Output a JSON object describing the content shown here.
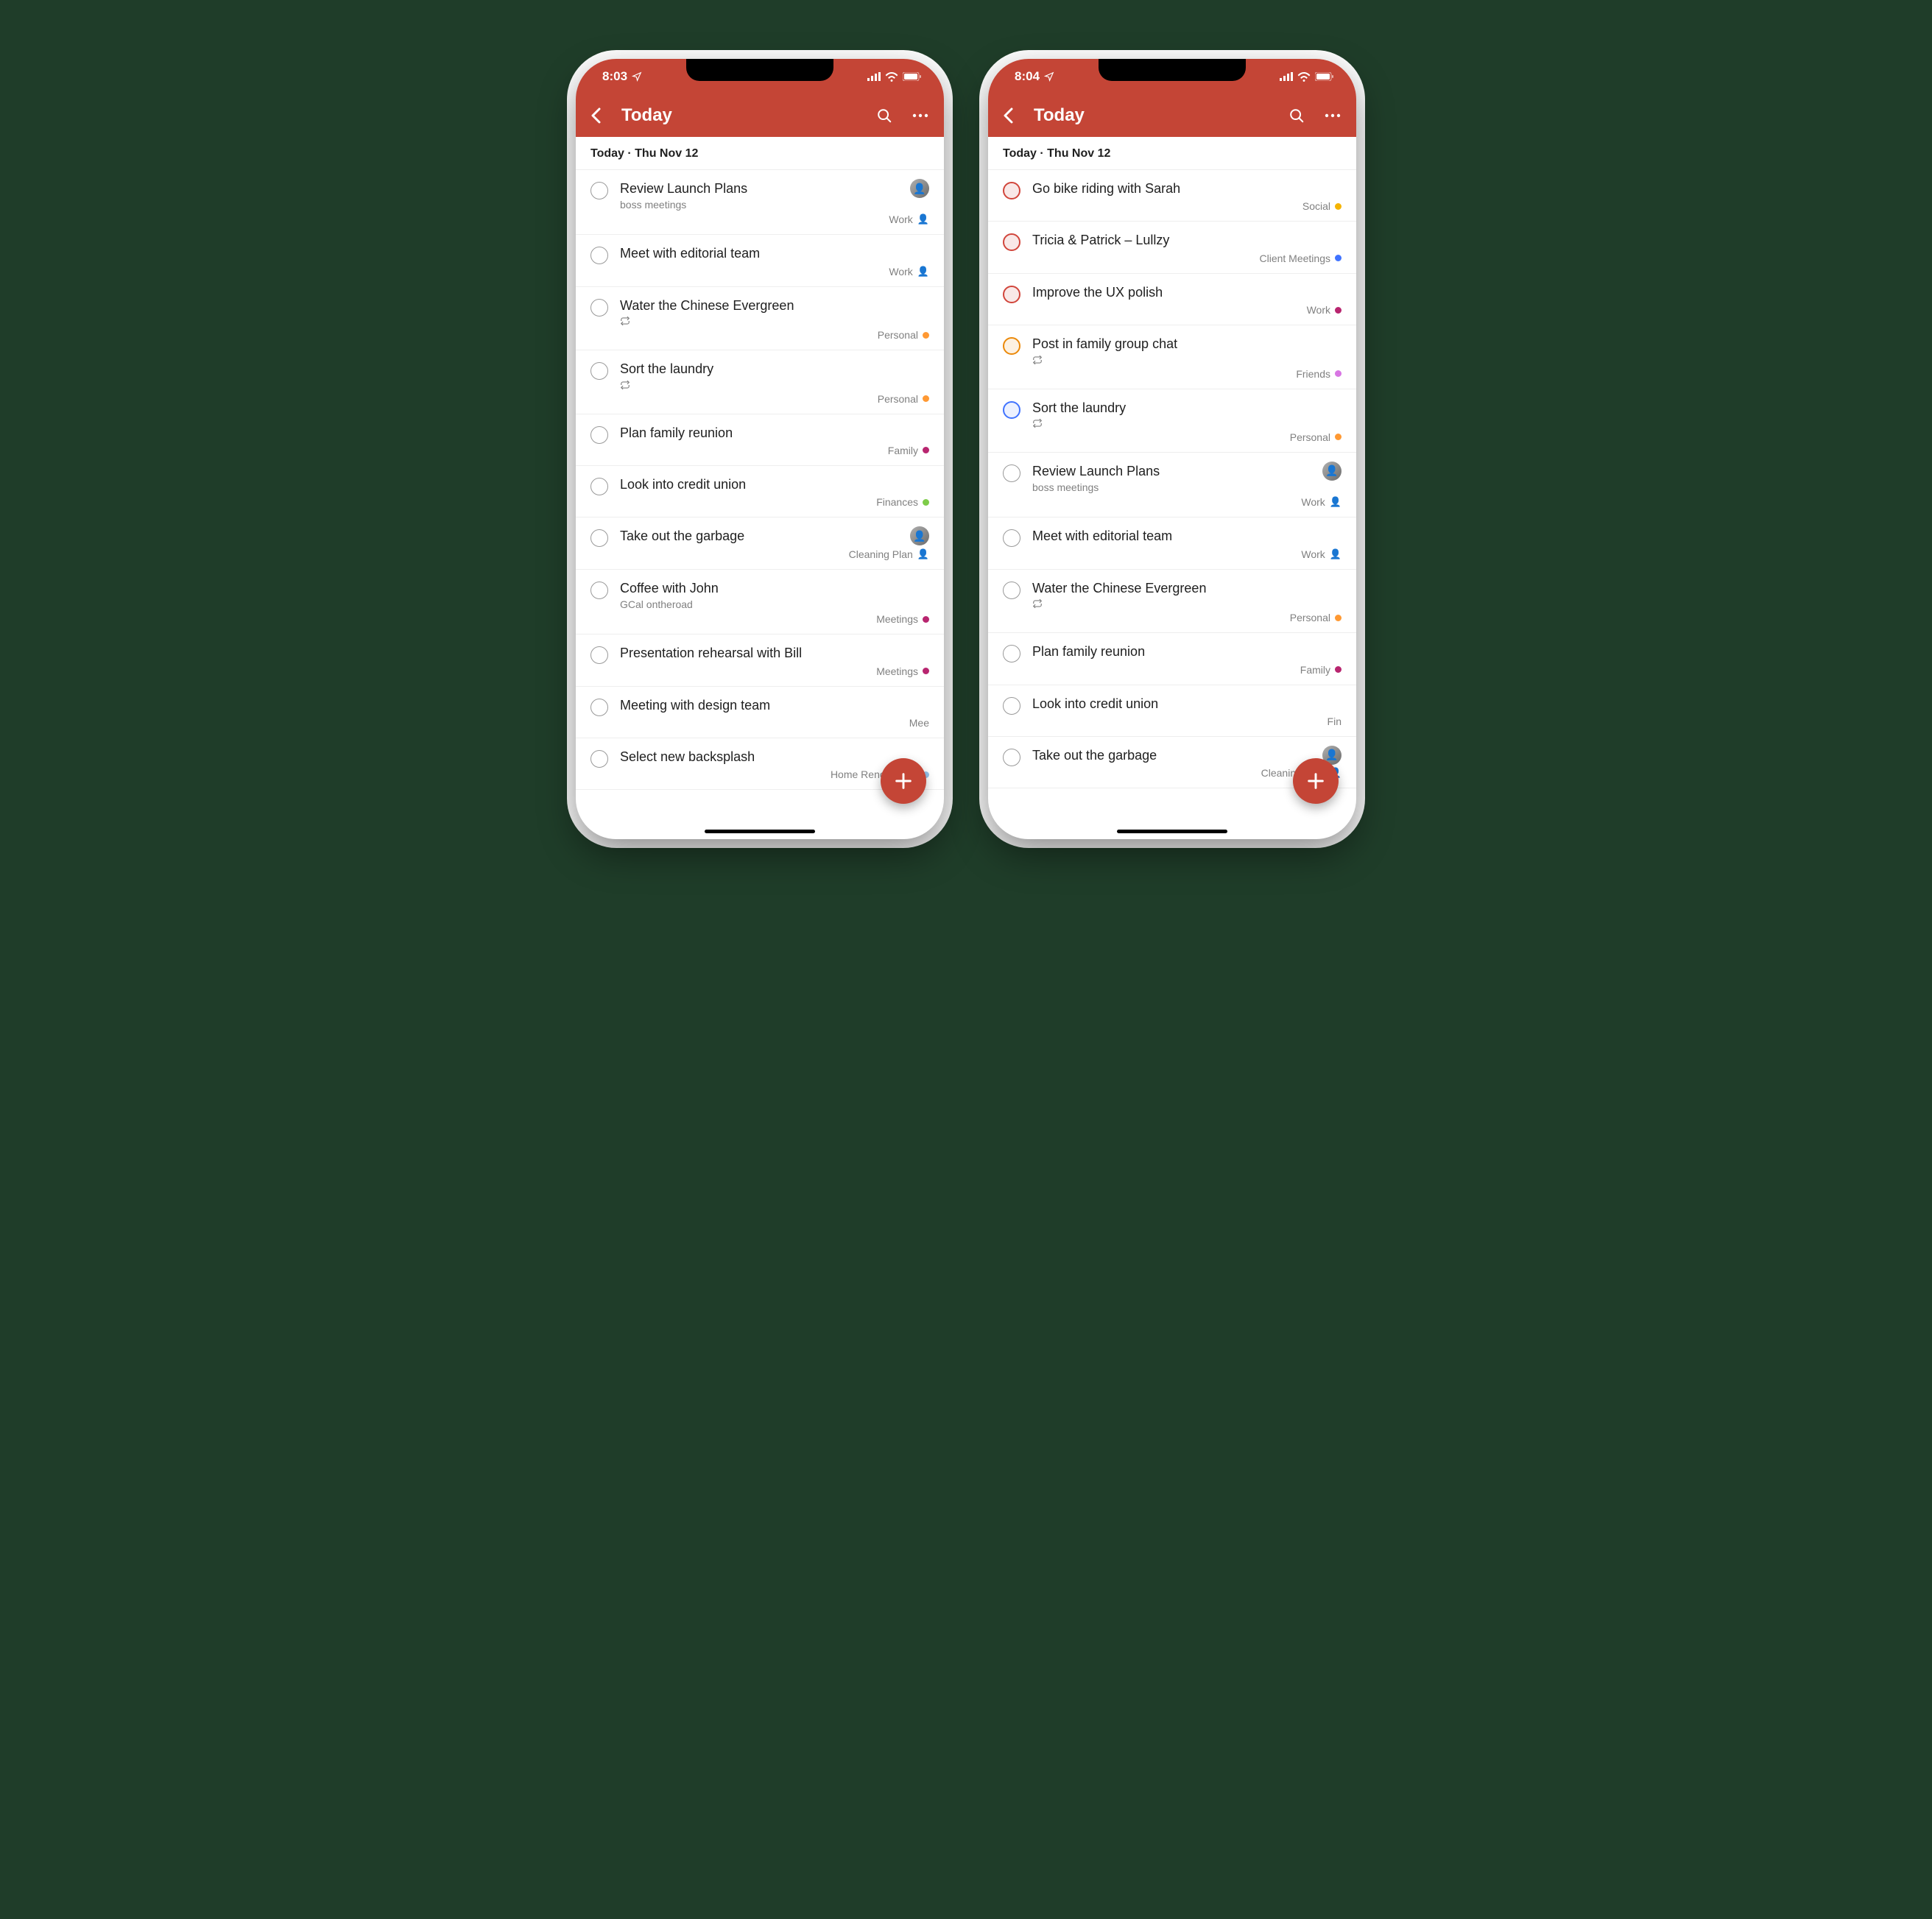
{
  "phones": [
    {
      "status": {
        "time": "8:03"
      },
      "header": {
        "title": "Today"
      },
      "section": "Today · Thu Nov 12",
      "tasks": [
        {
          "title": "Review Launch Plans",
          "subtitle": "boss meetings",
          "project": "Work",
          "projectIcon": "person",
          "projectColor": "#f5b400",
          "avatar": true,
          "priority": ""
        },
        {
          "title": "Meet with editorial team",
          "subtitle": "",
          "project": "Work",
          "projectIcon": "person",
          "projectColor": "#f5b400",
          "priority": ""
        },
        {
          "title": "Water the Chinese Evergreen",
          "subtitle": "",
          "recurring": true,
          "project": "Personal",
          "projectColor": "#ff9933",
          "priority": ""
        },
        {
          "title": "Sort the laundry",
          "subtitle": "",
          "recurring": true,
          "project": "Personal",
          "projectColor": "#ff9933",
          "priority": ""
        },
        {
          "title": "Plan family reunion",
          "subtitle": "",
          "project": "Family",
          "projectColor": "#b8256f",
          "priority": ""
        },
        {
          "title": "Look into credit union",
          "subtitle": "",
          "project": "Finances",
          "projectColor": "#7ecc49",
          "priority": ""
        },
        {
          "title": "Take out the garbage",
          "subtitle": "",
          "project": "Cleaning Plan",
          "projectIcon": "person",
          "projectColor": "#5ec5c5",
          "avatar": true,
          "priority": ""
        },
        {
          "title": "Coffee with John",
          "subtitle": "GCal ontheroad",
          "project": "Meetings",
          "projectColor": "#b8256f",
          "priority": ""
        },
        {
          "title": "Presentation rehearsal with Bill",
          "subtitle": "",
          "project": "Meetings",
          "projectColor": "#b8256f",
          "priority": ""
        },
        {
          "title": "Meeting with design team",
          "subtitle": "",
          "project": "Mee",
          "projectColor": "",
          "priority": ""
        },
        {
          "title": "Select new backsplash",
          "subtitle": "",
          "project": "Home Renovations",
          "projectColor": "#96c3eb",
          "priority": ""
        }
      ]
    },
    {
      "status": {
        "time": "8:04"
      },
      "header": {
        "title": "Today"
      },
      "section": "Today · Thu Nov 12",
      "tasks": [
        {
          "title": "Go bike riding with Sarah",
          "subtitle": "",
          "project": "Social",
          "projectColor": "#f5b400",
          "priority": "p1"
        },
        {
          "title": "Tricia & Patrick – Lullzy",
          "subtitle": "",
          "project": "Client Meetings",
          "projectColor": "#4073ff",
          "priority": "p1"
        },
        {
          "title": "Improve the UX polish",
          "subtitle": "",
          "project": "Work",
          "projectColor": "#b8256f",
          "priority": "p1"
        },
        {
          "title": "Post in family group chat",
          "subtitle": "",
          "recurring": true,
          "project": "Friends",
          "projectColor": "#d876e3",
          "priority": "p2"
        },
        {
          "title": "Sort the laundry",
          "subtitle": "",
          "recurring": true,
          "project": "Personal",
          "projectColor": "#ff9933",
          "priority": "p3"
        },
        {
          "title": "Review Launch Plans",
          "subtitle": "boss meetings",
          "project": "Work",
          "projectIcon": "person",
          "projectColor": "#f5b400",
          "avatar": true,
          "priority": ""
        },
        {
          "title": "Meet with editorial team",
          "subtitle": "",
          "project": "Work",
          "projectIcon": "person",
          "projectColor": "#f5b400",
          "priority": ""
        },
        {
          "title": "Water the Chinese Evergreen",
          "subtitle": "",
          "recurring": true,
          "project": "Personal",
          "projectColor": "#ff9933",
          "priority": ""
        },
        {
          "title": "Plan family reunion",
          "subtitle": "",
          "project": "Family",
          "projectColor": "#b8256f",
          "priority": ""
        },
        {
          "title": "Look into credit union",
          "subtitle": "",
          "project": "Fin",
          "projectColor": "",
          "priority": ""
        },
        {
          "title": "Take out the garbage",
          "subtitle": "",
          "project": "Cleaning Plan",
          "projectIcon": "person",
          "projectColor": "#5ec5c5",
          "avatar": true,
          "priority": ""
        }
      ]
    }
  ]
}
